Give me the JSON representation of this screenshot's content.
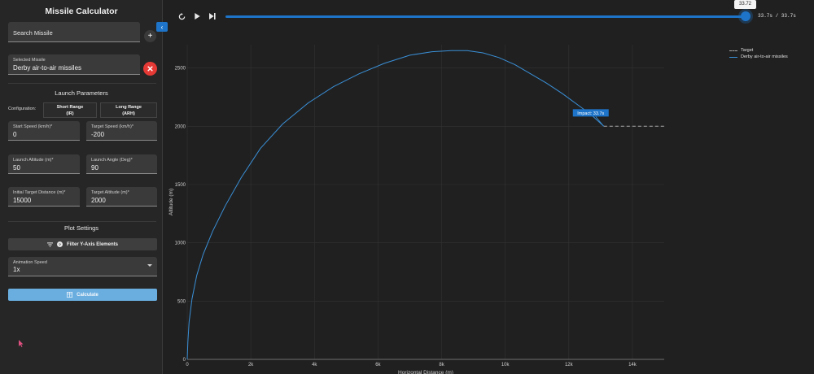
{
  "app": {
    "title": "Missile Calculator"
  },
  "search": {
    "placeholder": "Search Missile"
  },
  "selected": {
    "label": "Selected Missile",
    "value": "Derby air-to-air missiles"
  },
  "launch": {
    "title": "Launch Parameters",
    "config_label": "Configuration:",
    "config_options": [
      {
        "line1": "Short Range",
        "line2": "(IR)"
      },
      {
        "line1": "Long Range",
        "line2": "(ARH)"
      }
    ],
    "fields": {
      "start_speed": {
        "label": "Start Speed (km/h)*",
        "value": "0"
      },
      "target_speed": {
        "label": "Target Speed (km/h)*",
        "value": "-200"
      },
      "launch_altitude": {
        "label": "Launch Altitude (m)*",
        "value": "50"
      },
      "launch_angle": {
        "label": "Launch Angle (Deg)*",
        "value": "90"
      },
      "initial_distance": {
        "label": "Initial Target Distance (m)*",
        "value": "15000"
      },
      "target_altitude": {
        "label": "Target Altitude (m)*",
        "value": "2000"
      }
    }
  },
  "plot_settings": {
    "title": "Plot Settings",
    "filter_label": "Filter Y-Axis Elements",
    "animation_label": "Animation Speed",
    "animation_value": "1x",
    "calculate_label": "Calculate"
  },
  "player": {
    "tooltip": "33.72",
    "time_text": "33.7s / 33.7s",
    "progress": 1.0
  },
  "chart_data": {
    "type": "line",
    "xlabel": "Horizontal Distance (m)",
    "ylabel": "Altitude (m)",
    "xlim": [
      0,
      15000
    ],
    "ylim": [
      0,
      2700
    ],
    "x_ticks": [
      0,
      2000,
      4000,
      6000,
      8000,
      10000,
      12000,
      14000
    ],
    "x_tick_labels": [
      "0",
      "2k",
      "4k",
      "6k",
      "8k",
      "10k",
      "12k",
      "14k"
    ],
    "y_ticks": [
      0,
      500,
      1000,
      1500,
      2000,
      2500
    ],
    "y_tick_labels": [
      "0",
      "500",
      "1000",
      "1500",
      "2000",
      "2500"
    ],
    "grid": true,
    "legend_position": "top-right",
    "series": [
      {
        "name": "Target",
        "style": "dashed",
        "color": "#aaaaaa",
        "x": [
          13100,
          15000
        ],
        "y": [
          2000,
          2000
        ]
      },
      {
        "name": "Derby air-to-air missiles",
        "style": "solid",
        "color": "#3a8fd6",
        "x": [
          0,
          20,
          60,
          150,
          300,
          500,
          800,
          1200,
          1700,
          2300,
          3000,
          3800,
          4600,
          5400,
          6200,
          7000,
          7700,
          8300,
          8800,
          9300,
          9800,
          10300,
          10800,
          11300,
          11800,
          12300,
          12700,
          13100
        ],
        "y": [
          0,
          150,
          320,
          520,
          720,
          900,
          1100,
          1320,
          1560,
          1810,
          2020,
          2200,
          2340,
          2450,
          2540,
          2610,
          2640,
          2650,
          2650,
          2630,
          2590,
          2530,
          2450,
          2370,
          2280,
          2180,
          2100,
          2000
        ]
      }
    ],
    "annotations": [
      {
        "text": "Impact: 33.7s",
        "x": 13100,
        "y": 2000
      }
    ]
  },
  "colors": {
    "accent": "#1e74c8",
    "clear": "#e53935",
    "calculate": "#6aaee0"
  }
}
